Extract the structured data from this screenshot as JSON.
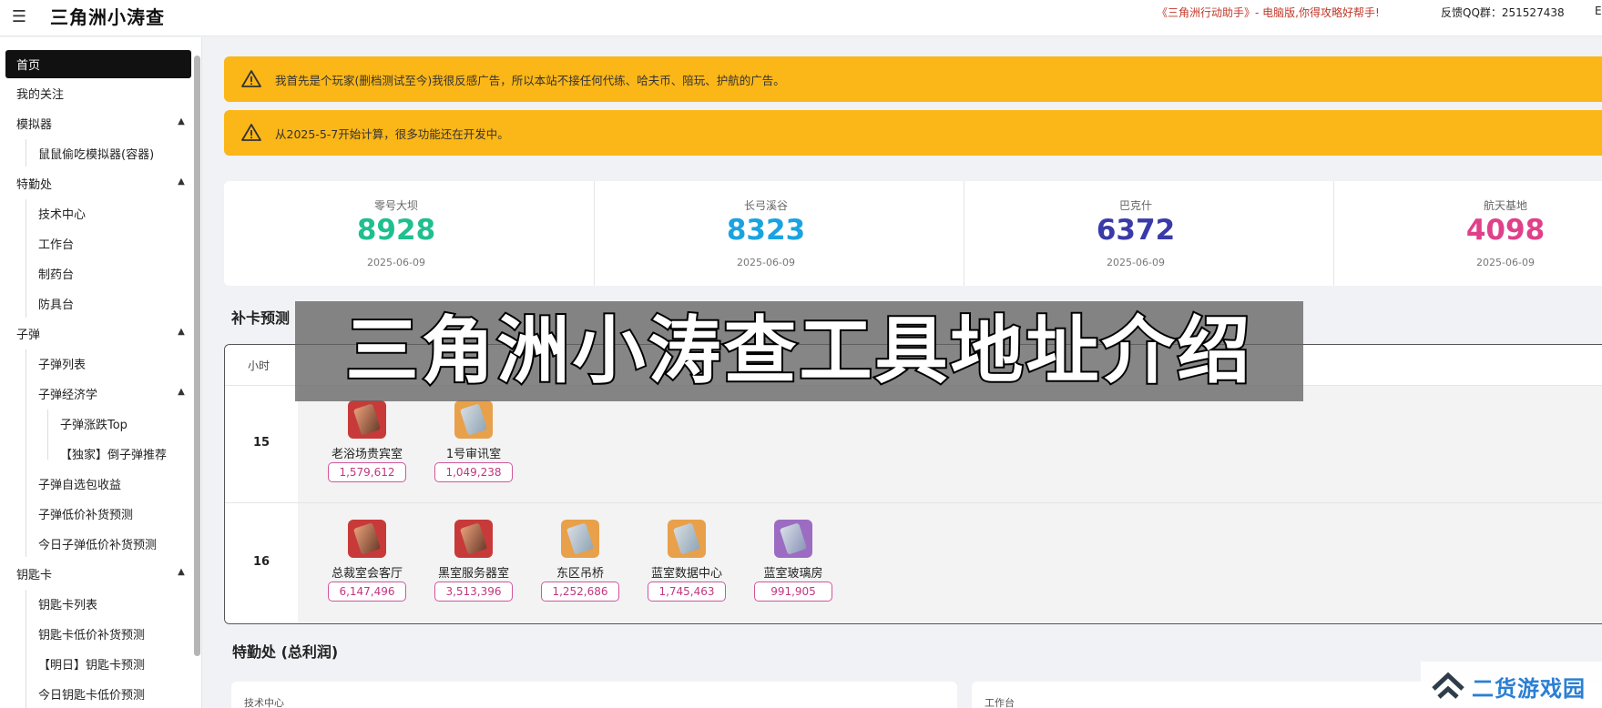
{
  "header": {
    "title": "三角洲小涛查",
    "notice": "《三角洲行动助手》- 电脑版,你得攻略好帮手!",
    "qq": "反馈QQ群：251527438",
    "edge_char": "E"
  },
  "sidebar": {
    "items": [
      {
        "label": "首页",
        "active": true
      },
      {
        "label": "我的关注"
      },
      {
        "label": "模拟器",
        "expandable": true
      },
      {
        "label": "鼠鼠偷吃模拟器(容器)"
      },
      {
        "label": "特勤处",
        "expandable": true
      },
      {
        "label": "技术中心"
      },
      {
        "label": "工作台"
      },
      {
        "label": "制药台"
      },
      {
        "label": "防具台"
      },
      {
        "label": "子弹",
        "expandable": true
      },
      {
        "label": "子弹列表"
      },
      {
        "label": "子弹经济学",
        "expandable": true
      },
      {
        "label": "子弹涨跌Top"
      },
      {
        "label": "【独家】倒子弹推荐"
      },
      {
        "label": "子弹自选包收益"
      },
      {
        "label": "子弹低价补货预测"
      },
      {
        "label": "今日子弹低价补货预测"
      },
      {
        "label": "钥匙卡",
        "expandable": true
      },
      {
        "label": "钥匙卡列表"
      },
      {
        "label": "钥匙卡低价补货预测"
      },
      {
        "label": "【明日】钥匙卡预测"
      },
      {
        "label": "今日钥匙卡低价预测"
      }
    ]
  },
  "alerts": [
    {
      "text": "我首先是个玩家(删档测试至今)我很反感广告，所以本站不接任何代练、哈夫币、陪玩、护航的广告。"
    },
    {
      "text": "从2025-5-7开始计算，很多功能还在开发中。"
    }
  ],
  "stats": [
    {
      "name": "零号大坝",
      "value": "8928",
      "date": "2025-06-09",
      "color": "#1fbf8f"
    },
    {
      "name": "长弓溪谷",
      "value": "8323",
      "date": "2025-06-09",
      "color": "#1aa3e0"
    },
    {
      "name": "巴克什",
      "value": "6372",
      "date": "2025-06-09",
      "color": "#3a3aa8"
    },
    {
      "name": "航天基地",
      "value": "4098",
      "date": "2025-06-09",
      "color": "#e0408a"
    }
  ],
  "prediction": {
    "title": "补卡预测",
    "hour_header": "小时",
    "rows": [
      {
        "hour": "15",
        "items": [
          {
            "name": "老浴场贵宾室",
            "value": "1,579,612",
            "color": "red"
          },
          {
            "name": "1号审讯室",
            "value": "1,049,238",
            "color": "gold"
          }
        ]
      },
      {
        "hour": "16",
        "items": [
          {
            "name": "总裁室会客厅",
            "value": "6,147,496",
            "color": "red"
          },
          {
            "name": "黑室服务器室",
            "value": "3,513,396",
            "color": "red"
          },
          {
            "name": "东区吊桥",
            "value": "1,252,686",
            "color": "gold"
          },
          {
            "name": "蓝室数据中心",
            "value": "1,745,463",
            "color": "gold"
          },
          {
            "name": "蓝室玻璃房",
            "value": "991,905",
            "color": "purple"
          }
        ]
      }
    ]
  },
  "special": {
    "title": "特勤处 (总利润)",
    "cards": [
      {
        "label": "技术中心"
      },
      {
        "label": "工作台"
      }
    ]
  },
  "overlay_text": "三角洲小涛查工具地址介绍",
  "watermark_text": "二货游戏园",
  "colors": {
    "alert_bg": "#fbb617",
    "value_pink": "#c2367f"
  }
}
